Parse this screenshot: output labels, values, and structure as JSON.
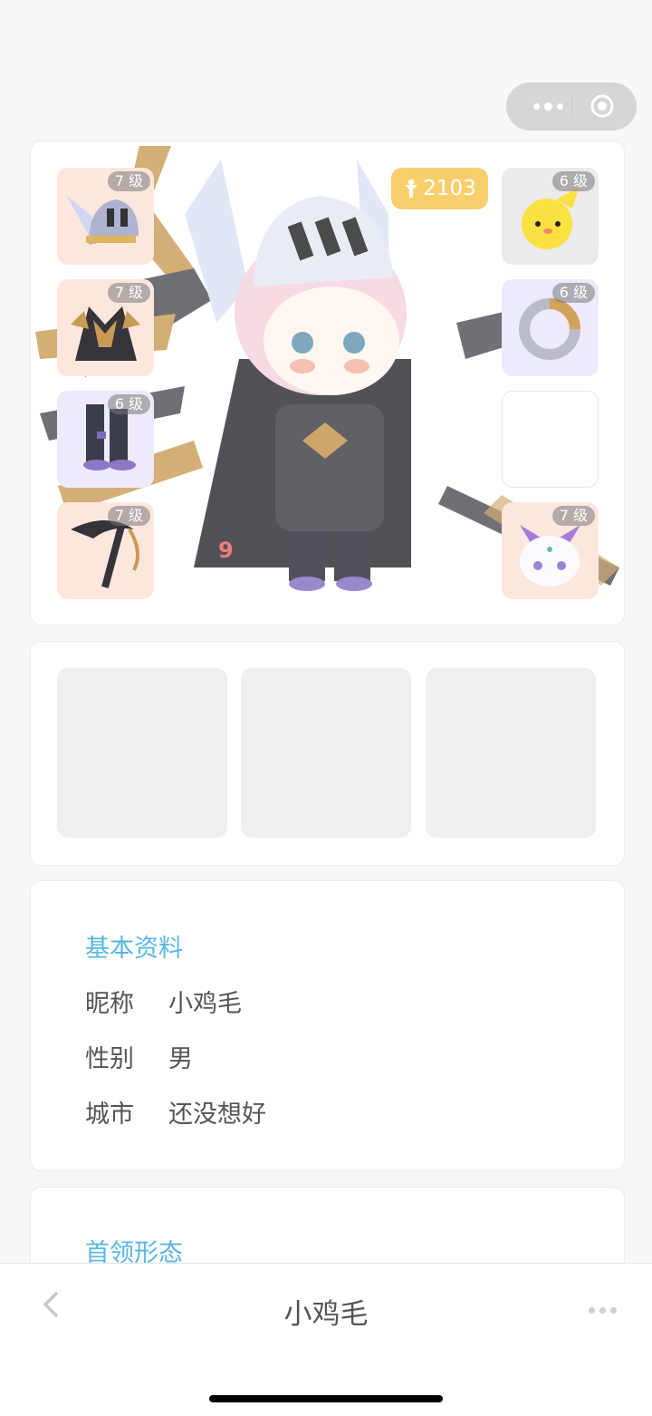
{
  "capsule": {
    "more_icon": "more-dots-icon",
    "target_icon": "target-icon"
  },
  "profile_card": {
    "power": {
      "icon": "power-figure-icon",
      "value": "2103"
    },
    "marker": "9",
    "left_slots": [
      {
        "item": "winged-helmet",
        "level": "7 级"
      },
      {
        "item": "dark-armor",
        "level": "7 级"
      },
      {
        "item": "dark-boots",
        "level": "6 级"
      },
      {
        "item": "dark-scythe",
        "level": "7 级"
      }
    ],
    "right_slots": [
      {
        "item": "yellow-chick-pet",
        "level": "6 级"
      },
      {
        "item": "serpent-ring",
        "level": "6 级"
      },
      {
        "item": "",
        "level": ""
      },
      {
        "item": "white-cat-pet",
        "level": "7 级"
      }
    ]
  },
  "info": {
    "title": "基本资料",
    "rows": [
      {
        "key": "昵称",
        "value": "小鸡毛"
      },
      {
        "key": "性别",
        "value": "男"
      },
      {
        "key": "城市",
        "value": "还没想好"
      }
    ]
  },
  "boss": {
    "title": "首领形态"
  },
  "bottom_bar": {
    "title": "小鸡毛"
  }
}
